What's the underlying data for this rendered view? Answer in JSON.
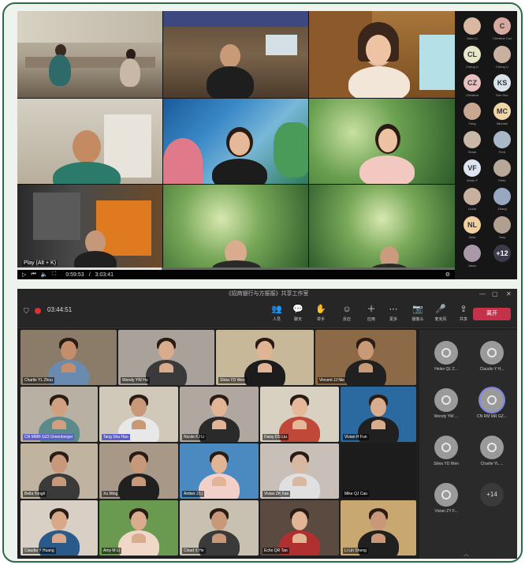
{
  "top": {
    "tooltip": "Play (Alt + K)",
    "time_current": "0:59:53",
    "time_separator": "/",
    "time_total": "3:03:41",
    "progress": 0.33,
    "participants": [
      {
        "label": "Amm Li",
        "initials": "",
        "color": "#d9b8a2"
      },
      {
        "label": "Christine Cox",
        "initials": "C",
        "color": "#d5a8a0"
      },
      {
        "label": "Cheng Li",
        "initials": "CL",
        "color": "#e6e6c8"
      },
      {
        "label": "Cheng Li",
        "initials": "",
        "color": "#c9b0a0"
      },
      {
        "label": "Christina",
        "initials": "CZ",
        "color": "#e8c0c0"
      },
      {
        "label": "Ken Seo",
        "initials": "KS",
        "color": "#d9e3ea"
      },
      {
        "label": "Fang",
        "initials": "",
        "color": "#c8a890"
      },
      {
        "label": "Michael",
        "initials": "MC",
        "color": "#f0d5a8"
      },
      {
        "label": "Vivian",
        "initials": "",
        "color": "#c9b8a8"
      },
      {
        "label": "Fred",
        "initials": "",
        "color": "#a8b8c8"
      },
      {
        "label": "Vivian F",
        "initials": "VF",
        "color": "#dde6f0"
      },
      {
        "label": "Peter",
        "initials": "",
        "color": "#b8a898"
      },
      {
        "label": "Linda",
        "initials": "",
        "color": "#c8b0a0"
      },
      {
        "label": "Zhang",
        "initials": "",
        "color": "#98a8c0"
      },
      {
        "label": "Nina",
        "initials": "NL",
        "color": "#f0d0a0"
      },
      {
        "label": "Tony",
        "initials": "",
        "color": "#b0a090"
      },
      {
        "label": "Jason",
        "initials": "",
        "color": "#a898a8"
      },
      {
        "label": "",
        "initials": "+12",
        "color": "#3a3a4a"
      }
    ]
  },
  "bottom": {
    "window_title": "《招商银行与方振振》共享工作室",
    "timer": "03:44:51",
    "toolbar": [
      {
        "icon": "people-icon",
        "glyph": "👥",
        "label": "人员"
      },
      {
        "icon": "chat-icon",
        "glyph": "💬",
        "label": "聊天"
      },
      {
        "icon": "hand-icon",
        "glyph": "✋",
        "label": "举手"
      },
      {
        "icon": "react-icon",
        "glyph": "☺",
        "label": "反应"
      },
      {
        "icon": "apps-icon",
        "glyph": "＋",
        "label": "应用"
      },
      {
        "icon": "more-icon",
        "glyph": "⋯",
        "label": "更多"
      },
      {
        "icon": "camera-icon",
        "glyph": "📷",
        "label": "摄像头"
      },
      {
        "icon": "mic-icon",
        "glyph": "🎤",
        "label": "麦克风"
      },
      {
        "icon": "share-icon",
        "glyph": "⇪",
        "label": "共享"
      }
    ],
    "leave_label": "离开",
    "tiles": [
      {
        "name": "Charlie YL Zhou",
        "hl": false
      },
      {
        "name": "Wendy YW Hu",
        "hl": false
      },
      {
        "name": "Silvia YD Wen",
        "hl": false
      },
      {
        "name": "Vincent JJ Nie",
        "hl": false
      },
      {
        "name": "CN MMR GZ2 Greenberger",
        "hl": true
      },
      {
        "name": "Tang Shu Hao",
        "hl": true
      },
      {
        "name": "Nicole FJ Li",
        "hl": false
      },
      {
        "name": "Daisy DS Liu",
        "hl": false
      },
      {
        "name": "Vivian H Fun",
        "hl": false
      },
      {
        "name": "Bella Yongli",
        "hl": false
      },
      {
        "name": "Xu Ming",
        "hl": false
      },
      {
        "name": "Amber J Li",
        "hl": false
      },
      {
        "name": "Vivian ZK Fan",
        "hl": false
      },
      {
        "name": "Mike QJ Cao",
        "hl": false
      },
      {
        "name": "Claudia Y Huang",
        "hl": false
      },
      {
        "name": "Amy M Li",
        "hl": false
      },
      {
        "name": "Cloud X He",
        "hl": false
      },
      {
        "name": "Echo QR Tan",
        "hl": false
      },
      {
        "name": "Li Lin Sheng",
        "hl": false
      }
    ],
    "right_panel": [
      {
        "name": "Helen QL Z..."
      },
      {
        "name": "Claudio Y H..."
      },
      {
        "name": "Wendy YW ..."
      },
      {
        "name": "CN RM MR GZ..."
      },
      {
        "name": "Silvia YD Wen"
      },
      {
        "name": "Charlie YL ..."
      },
      {
        "name": "Vivian ZY F..."
      }
    ],
    "more_count": "+14"
  }
}
